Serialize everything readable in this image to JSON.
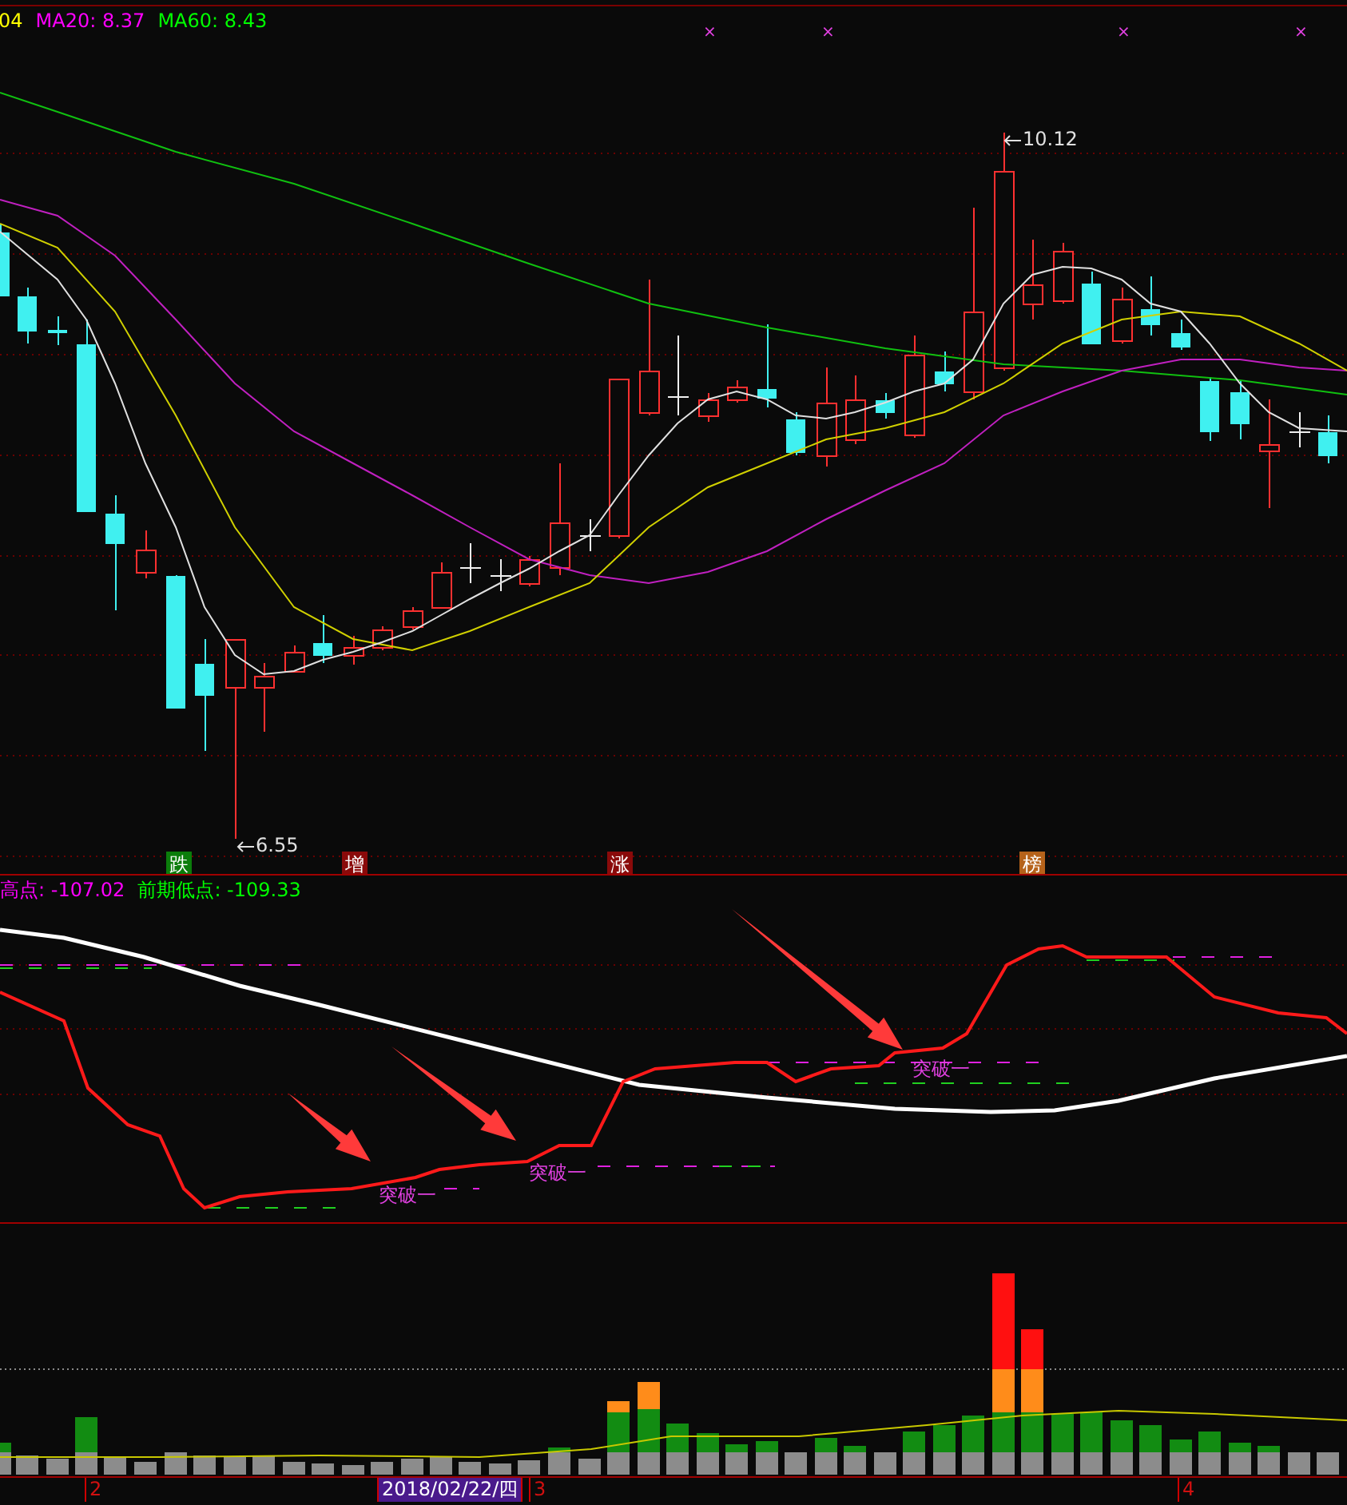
{
  "main_chart": {
    "legend": [
      {
        "text": "04",
        "color": "#ffff00"
      },
      {
        "text": "MA20: 8.37",
        "color": "#ff00ff"
      },
      {
        "text": "MA60: 8.43",
        "color": "#00ff00"
      }
    ],
    "signal_marks": [
      "×",
      "×",
      "×",
      "×"
    ],
    "high_label": "10.12",
    "low_label": "6.55",
    "tags": [
      {
        "text": "跌",
        "color": "#0b7d0b"
      },
      {
        "text": "增",
        "color": "#8a0a0a"
      },
      {
        "text": "涨",
        "color": "#8a0a0a"
      },
      {
        "text": "榜",
        "color": "#b5621a"
      }
    ]
  },
  "indicator": {
    "legend": [
      {
        "text": "高点: -107.02",
        "color": "#ff00ff"
      },
      {
        "text": "前期低点: -109.33",
        "color": "#00ff00"
      }
    ],
    "breakouts": [
      "突破一",
      "突破一",
      "突破一"
    ]
  },
  "time_axis": {
    "labels": [
      {
        "text": "2",
        "selected": false
      },
      {
        "text": "2018/02/22/四",
        "selected": true
      },
      {
        "text": "3",
        "selected": false
      },
      {
        "text": "4",
        "selected": false
      }
    ]
  }
}
